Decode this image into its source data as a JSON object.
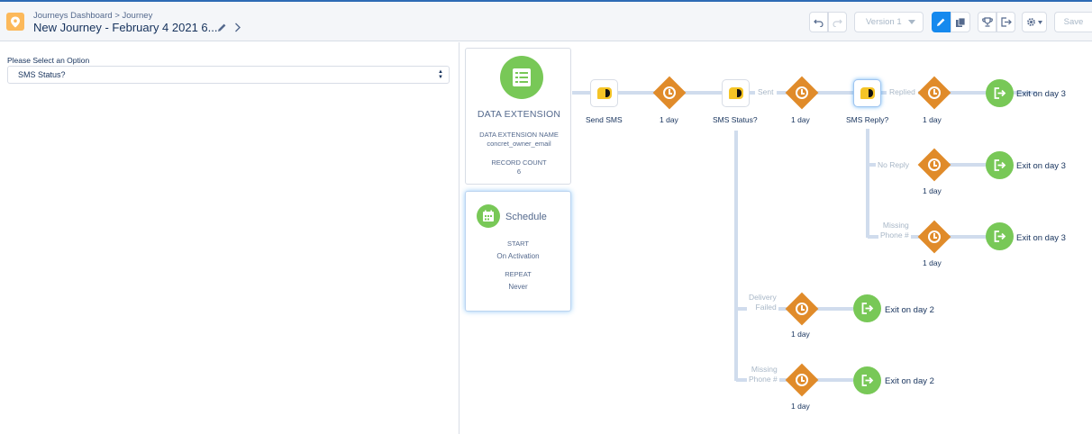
{
  "header": {
    "breadcrumb_parent": "Journeys Dashboard",
    "breadcrumb_sep": ">",
    "breadcrumb_current": "Journey",
    "title": "New Journey - February 4 2021 6...",
    "version_label": "Version 1",
    "save_label": "Save"
  },
  "left_panel": {
    "label": "Please Select an Option",
    "select_value": "SMS Status?"
  },
  "entry": {
    "title": "DATA EXTENSION",
    "name_label": "DATA EXTENSION NAME",
    "name_value": "concret_owner_email",
    "count_label": "RECORD COUNT",
    "count_value": "6"
  },
  "schedule": {
    "title": "Schedule",
    "start_label": "START",
    "start_value": "On Activation",
    "repeat_label": "REPEAT",
    "repeat_value": "Never"
  },
  "nodes": {
    "send_sms": "Send SMS",
    "wait1": "1 day",
    "sms_status": "SMS Status?",
    "wait_sent": "1 day",
    "sms_reply": "SMS Reply?",
    "wait_replied": "1 day",
    "exit_replied": "Exit on day 3",
    "wait_noreply": "1 day",
    "exit_noreply": "Exit on day 3",
    "wait_missing1": "1 day",
    "exit_missing1": "Exit on day 3",
    "wait_failed": "1 day",
    "exit_failed": "Exit on day 2",
    "wait_missing2": "1 day",
    "exit_missing2": "Exit on day 2"
  },
  "branches": {
    "sent": "Sent",
    "replied": "Replied",
    "no_reply": "No Reply",
    "missing1_line1": "Missing",
    "missing1_line2": "Phone #",
    "failed_line1": "Delivery",
    "failed_line2": "Failed",
    "missing2_line1": "Missing",
    "missing2_line2": "Phone #"
  },
  "colors": {
    "accent": "#1589ee",
    "green": "#78c857",
    "orange": "#e08b2a",
    "line": "#d0dced"
  }
}
